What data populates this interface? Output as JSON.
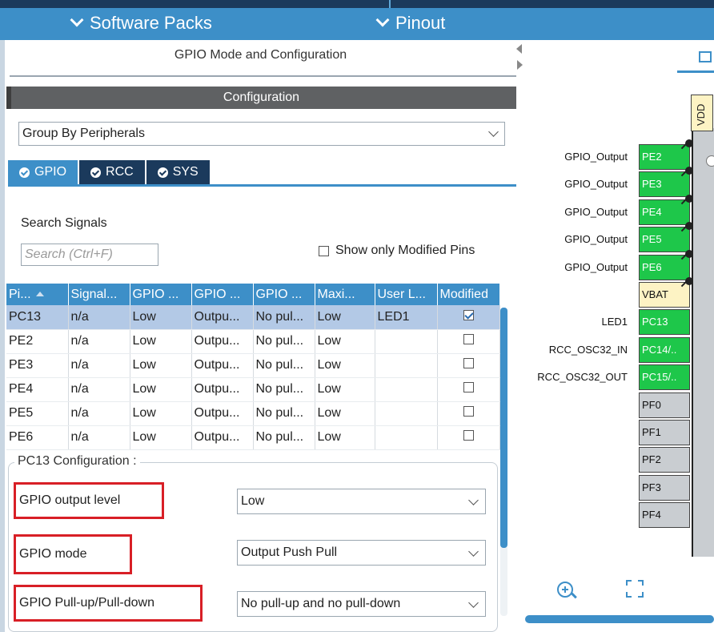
{
  "nav": {
    "software_packs": "Software Packs",
    "pinout": "Pinout"
  },
  "panel": {
    "title": "GPIO Mode and Configuration",
    "config_header": "Configuration",
    "group_by": "Group By Peripherals"
  },
  "tabs": [
    {
      "label": "GPIO",
      "active": true
    },
    {
      "label": "RCC",
      "active": false
    },
    {
      "label": "SYS",
      "active": false
    }
  ],
  "search": {
    "label": "Search Signals",
    "placeholder": "Search (Ctrl+F)",
    "show_modified_label": "Show only Modified Pins",
    "show_modified_checked": false
  },
  "table": {
    "headers": [
      "Pi...",
      "Signal...",
      "GPIO ...",
      "GPIO ...",
      "GPIO ...",
      "Maxi...",
      "User L...",
      "Modified"
    ],
    "rows": [
      {
        "pin": "PC13",
        "signal": "n/a",
        "level": "Low",
        "mode": "Outpu...",
        "pull": "No pul...",
        "speed": "Low",
        "label": "LED1",
        "modified": true,
        "selected": true
      },
      {
        "pin": "PE2",
        "signal": "n/a",
        "level": "Low",
        "mode": "Outpu...",
        "pull": "No pul...",
        "speed": "Low",
        "label": "",
        "modified": false,
        "selected": false
      },
      {
        "pin": "PE3",
        "signal": "n/a",
        "level": "Low",
        "mode": "Outpu...",
        "pull": "No pul...",
        "speed": "Low",
        "label": "",
        "modified": false,
        "selected": false
      },
      {
        "pin": "PE4",
        "signal": "n/a",
        "level": "Low",
        "mode": "Outpu...",
        "pull": "No pul...",
        "speed": "Low",
        "label": "",
        "modified": false,
        "selected": false
      },
      {
        "pin": "PE5",
        "signal": "n/a",
        "level": "Low",
        "mode": "Outpu...",
        "pull": "No pul...",
        "speed": "Low",
        "label": "",
        "modified": false,
        "selected": false
      },
      {
        "pin": "PE6",
        "signal": "n/a",
        "level": "Low",
        "mode": "Outpu...",
        "pull": "No pul...",
        "speed": "Low",
        "label": "",
        "modified": false,
        "selected": false
      }
    ]
  },
  "pin_config": {
    "legend": "PC13 Configuration :",
    "output_level_label": "GPIO output level",
    "output_level_value": "Low",
    "mode_label": "GPIO mode",
    "mode_value": "Output Push Pull",
    "pull_label": "GPIO Pull-up/Pull-down",
    "pull_value": "No pull-up and no pull-down"
  },
  "chip": {
    "vdd": "VDD",
    "pins": [
      {
        "label": "GPIO_Output",
        "name": "PE2",
        "color": "green"
      },
      {
        "label": "GPIO_Output",
        "name": "PE3",
        "color": "green"
      },
      {
        "label": "GPIO_Output",
        "name": "PE4",
        "color": "green"
      },
      {
        "label": "GPIO_Output",
        "name": "PE5",
        "color": "green"
      },
      {
        "label": "GPIO_Output",
        "name": "PE6",
        "color": "green"
      },
      {
        "label": "",
        "name": "VBAT",
        "color": "yellow"
      },
      {
        "label": "LED1",
        "name": "PC13",
        "color": "green"
      },
      {
        "label": "RCC_OSC32_IN",
        "name": "PC14/..",
        "color": "green"
      },
      {
        "label": "RCC_OSC32_OUT",
        "name": "PC15/..",
        "color": "green"
      },
      {
        "label": "",
        "name": "PF0",
        "color": "gray"
      },
      {
        "label": "",
        "name": "PF1",
        "color": "gray"
      },
      {
        "label": "",
        "name": "PF2",
        "color": "gray"
      },
      {
        "label": "",
        "name": "PF3",
        "color": "gray"
      },
      {
        "label": "",
        "name": "PF4",
        "color": "gray"
      }
    ]
  },
  "colors": {
    "accent": "#3d8fc8",
    "navy": "#1b3a5c",
    "pin_green": "#1ec74a",
    "highlight_red": "#d81f26"
  },
  "icons": {
    "zoom_in": "zoom-in-icon",
    "fit": "fit-to-screen-icon",
    "chip": "chip-icon"
  }
}
